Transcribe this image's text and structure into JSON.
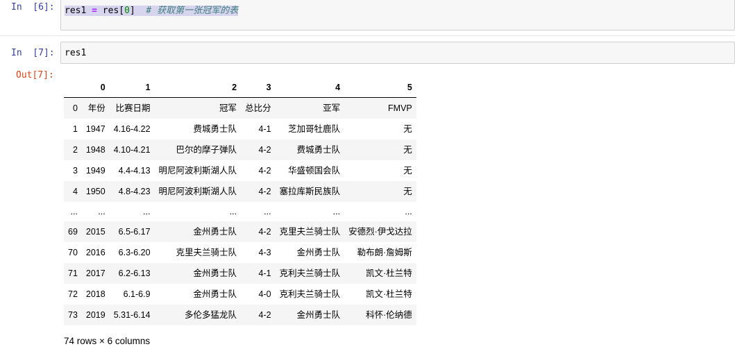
{
  "cells": {
    "cell6": {
      "prompt": "In  [6]:",
      "code_var": "res1",
      "code_eq": "=",
      "code_rhs_name": "res",
      "code_open": "[",
      "code_index": "0",
      "code_close": "]",
      "code_comment": "# 获取第一张冠军的表"
    },
    "cell7": {
      "prompt": "In  [7]:",
      "code": "res1",
      "out_prompt": "Out[7]:"
    }
  },
  "dataframe": {
    "columns": [
      "",
      "0",
      "1",
      "2",
      "3",
      "4",
      "5"
    ],
    "rows": [
      [
        "0",
        "年份",
        "比赛日期",
        "冠军",
        "总比分",
        "亚军",
        "FMVP"
      ],
      [
        "1",
        "1947",
        "4.16-4.22",
        "费城勇士队",
        "4-1",
        "芝加哥牡鹿队",
        "无"
      ],
      [
        "2",
        "1948",
        "4.10-4.21",
        "巴尔的摩子弹队",
        "4-2",
        "费城勇士队",
        "无"
      ],
      [
        "3",
        "1949",
        "4.4-4.13",
        "明尼阿波利斯湖人队",
        "4-2",
        "华盛顿国会队",
        "无"
      ],
      [
        "4",
        "1950",
        "4.8-4.23",
        "明尼阿波利斯湖人队",
        "4-2",
        "塞拉库斯民族队",
        "无"
      ],
      [
        "...",
        "...",
        "...",
        "...",
        "...",
        "...",
        "..."
      ],
      [
        "69",
        "2015",
        "6.5-6.17",
        "金州勇士队",
        "4-2",
        "克里夫兰骑士队",
        "安德烈·伊戈达拉"
      ],
      [
        "70",
        "2016",
        "6.3-6.20",
        "克里夫兰骑士队",
        "4-3",
        "金州勇士队",
        "勒布朗·詹姆斯"
      ],
      [
        "71",
        "2017",
        "6.2-6.13",
        "金州勇士队",
        "4-1",
        "克利夫兰骑士队",
        "凯文·杜兰特"
      ],
      [
        "72",
        "2018",
        "6.1-6.9",
        "金州勇士队",
        "4-0",
        "克利夫兰骑士队",
        "凯文·杜兰特"
      ],
      [
        "73",
        "2019",
        "5.31-6.14",
        "多伦多猛龙队",
        "4-2",
        "金州勇士队",
        "科怀·伦纳德"
      ]
    ],
    "footer": "74 rows × 6 columns"
  },
  "colors": {
    "in_prompt": "#303f9f",
    "out_prompt": "#d84315",
    "input_bg": "#f7f7f7",
    "selection": "#d7d4f0",
    "row_striped": "#f5f5f5"
  }
}
